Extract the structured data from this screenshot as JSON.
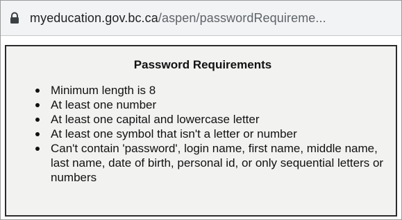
{
  "browser": {
    "url_domain": "myeducation.gov.bc.ca",
    "url_path": "/aspen/passwordRequireme...",
    "lock_icon": "lock-icon"
  },
  "dialog": {
    "title": "Password Requirements",
    "requirements": [
      "Minimum length is 8",
      "At least one number",
      "At least one capital and lowercase letter",
      "At least one symbol that isn't a letter or number",
      "Can't contain 'password', login name, first name, middle name, last name, date of birth, personal id, or only sequential letters or numbers"
    ]
  },
  "colors": {
    "urlbar_bg": "#f1f3f4",
    "content_bg": "#f2f2f1",
    "border": "#2b2b2b"
  }
}
